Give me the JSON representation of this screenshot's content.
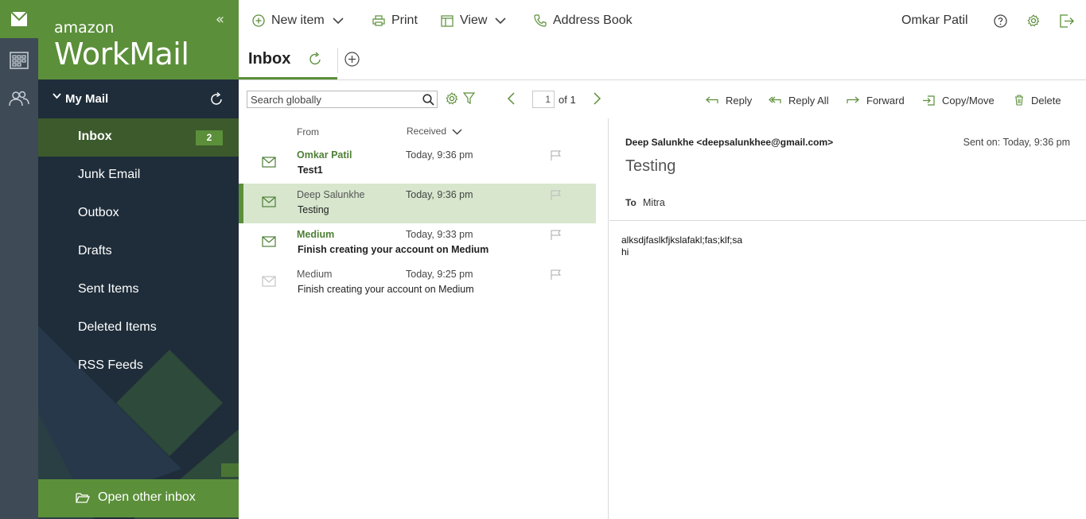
{
  "colors": {
    "brand_green": "#5b8f3a",
    "sidebar_dark": "#1f2d3a",
    "rail": "#3e4a56",
    "selected_row": "#d7e6cd"
  },
  "rail": {
    "items": [
      "mail-icon",
      "calendar-icon",
      "contacts-icon"
    ]
  },
  "brand": {
    "line1": "amazon",
    "line2": "WorkMail",
    "collapse": "«"
  },
  "sidebar": {
    "section_label": "My Mail",
    "folders": [
      {
        "label": "Inbox",
        "badge": "2"
      },
      {
        "label": "Junk Email"
      },
      {
        "label": "Outbox"
      },
      {
        "label": "Drafts"
      },
      {
        "label": "Sent Items"
      },
      {
        "label": "Deleted Items"
      },
      {
        "label": "RSS Feeds"
      }
    ],
    "open_other_inbox": "Open other inbox"
  },
  "toolbar": {
    "new_item": "New item",
    "print": "Print",
    "view": "View",
    "address_book": "Address Book",
    "user_name": "Omkar Patil"
  },
  "tab": {
    "title": "Inbox"
  },
  "list_toolbar": {
    "search_placeholder": "Search globally",
    "page_current": "1",
    "page_of": "of 1"
  },
  "actions": {
    "reply": "Reply",
    "reply_all": "Reply All",
    "forward": "Forward",
    "copy_move": "Copy/Move",
    "delete": "Delete"
  },
  "list": {
    "col_from": "From",
    "col_received": "Received",
    "messages": [
      {
        "from": "Omkar Patil",
        "time": "Today, 9:36 pm",
        "subject": "Test1",
        "unread": true
      },
      {
        "from": "Deep Salunkhe",
        "time": "Today, 9:36 pm",
        "subject": "Testing",
        "unread": false,
        "selected": true
      },
      {
        "from": "Medium",
        "time": "Today, 9:33 pm",
        "subject": "Finish creating your account on Medium",
        "unread": true
      },
      {
        "from": "Medium",
        "time": "Today, 9:25 pm",
        "subject": "Finish creating your account on Medium",
        "unread": false
      }
    ]
  },
  "reader": {
    "sender": "Deep Salunkhe <deepsalunkhee@gmail.com>",
    "sent": "Sent on: Today, 9:36 pm",
    "subject": "Testing",
    "to_label": "To",
    "to": "Mitra",
    "body_line1": "alksdjfaslkfjkslafakl;fas;klf;sa",
    "body_line2": "hi"
  }
}
